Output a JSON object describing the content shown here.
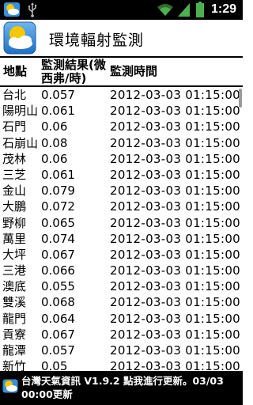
{
  "status_bar": {
    "time": "1:29",
    "icons": [
      "weather-app-icon",
      "usb-icon",
      "wifi-icon",
      "signal-icon",
      "battery-icon"
    ]
  },
  "app": {
    "title": "環境輻射監測",
    "icon": "sun-cloud-icon"
  },
  "table": {
    "headers": {
      "site": "地點",
      "result": "監測結果(微西弗/時)",
      "time": "監測時間"
    },
    "rows": [
      {
        "site": "台北",
        "value": "0.057",
        "time": "2012-03-03 01:15:00"
      },
      {
        "site": "陽明山",
        "value": "0.061",
        "time": "2012-03-03 01:15:00"
      },
      {
        "site": "石門",
        "value": "0.06",
        "time": "2012-03-03 01:15:00"
      },
      {
        "site": "石崩山",
        "value": "0.08",
        "time": "2012-03-03 01:15:00"
      },
      {
        "site": "茂林",
        "value": "0.06",
        "time": "2012-03-03 01:15:00"
      },
      {
        "site": "三芝",
        "value": "0.061",
        "time": "2012-03-03 01:15:00"
      },
      {
        "site": "金山",
        "value": "0.079",
        "time": "2012-03-03 01:15:00"
      },
      {
        "site": "大鵬",
        "value": "0.072",
        "time": "2012-03-03 01:15:00"
      },
      {
        "site": "野柳",
        "value": "0.065",
        "time": "2012-03-03 01:15:00"
      },
      {
        "site": "萬里",
        "value": "0.074",
        "time": "2012-03-03 01:15:00"
      },
      {
        "site": "大坪",
        "value": "0.067",
        "time": "2012-03-03 01:15:00"
      },
      {
        "site": "三港",
        "value": "0.066",
        "time": "2012-03-03 01:15:00"
      },
      {
        "site": "澳底",
        "value": "0.055",
        "time": "2012-03-03 01:15:00"
      },
      {
        "site": "雙溪",
        "value": "0.068",
        "time": "2012-03-03 01:15:00"
      },
      {
        "site": "龍門",
        "value": "0.064",
        "time": "2012-03-03 01:15:00"
      },
      {
        "site": "貢寮",
        "value": "0.067",
        "time": "2012-03-03 01:15:00"
      },
      {
        "site": "龍潭",
        "value": "0.057",
        "time": "2012-03-03 01:15:00"
      },
      {
        "site": "新竹",
        "value": "0.05",
        "time": "2012-03-03 01:15:00"
      }
    ]
  },
  "notification": {
    "icon": "sun-cloud-icon",
    "text": "台灣天氣資訊 V1.9.2  點我進行更新。03/03 00:00更新"
  },
  "colors": {
    "status_bar_bg": "#000000",
    "page_bg": "#ffffff",
    "text": "#000000",
    "sun": "#f5c800",
    "sky": "#3a8fd9"
  }
}
